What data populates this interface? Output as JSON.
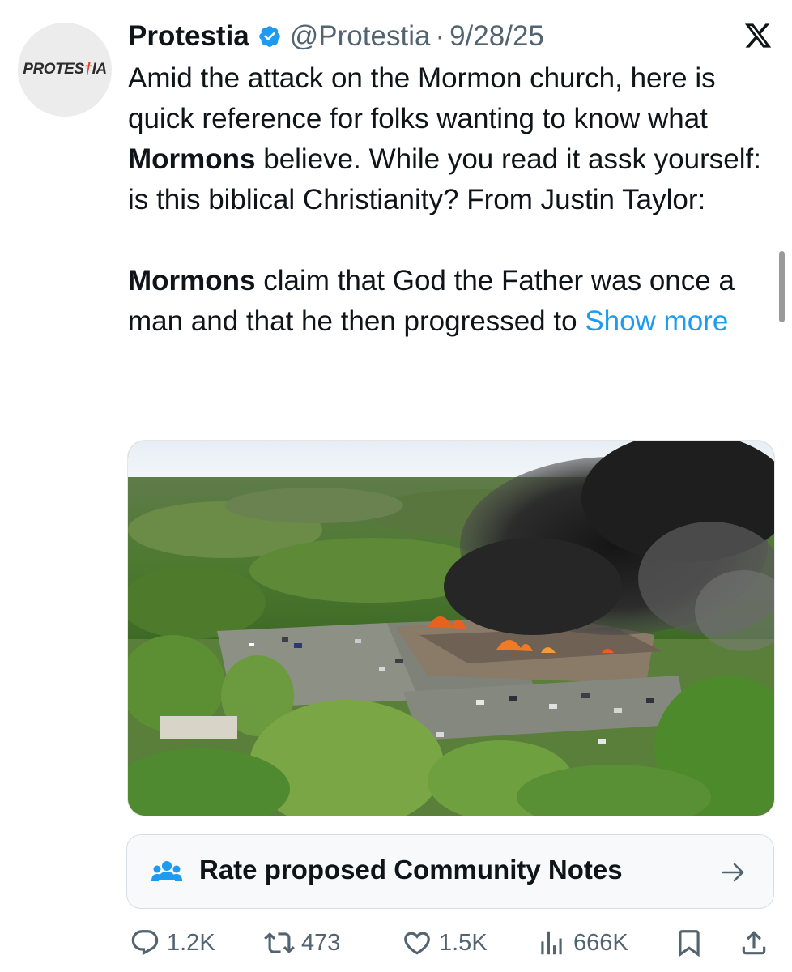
{
  "tweet": {
    "author": {
      "avatar_text": "PROTESTIA",
      "display_name": "Protestia",
      "handle": "@Protestia",
      "separator": "·",
      "date": "9/28/25",
      "verified": true,
      "verified_color": "#1d9bf0"
    },
    "platform_icon": "x-logo-icon",
    "text": {
      "p1_a": "Amid the attack on the Mormon church, here is quick reference for folks wanting to know what ",
      "p1_bold": "Mormons",
      "p1_b": " believe. While you read it assk yourself: is this biblical Christianity? From Justin Taylor:",
      "p2_bold": "Mormons",
      "p2_a": " claim that God the Father was once a man and that he then progressed to ",
      "show_more": "Show more"
    },
    "media": {
      "kind": "photo",
      "subject": "aerial view of a church building on fire with heavy black smoke"
    },
    "community_notes": {
      "icon": "people-group-icon",
      "label": "Rate proposed Community Notes",
      "arrow": "arrow-right-icon"
    },
    "actions": {
      "replies": "1.2K",
      "reposts": "473",
      "likes": "1.5K",
      "views": "666K"
    }
  },
  "colors": {
    "text": "#0f1419",
    "secondary": "#536471",
    "link": "#1d9bf0",
    "community_notes_icon": "#1d9bf0",
    "avatar_accent": "#e0472a"
  }
}
